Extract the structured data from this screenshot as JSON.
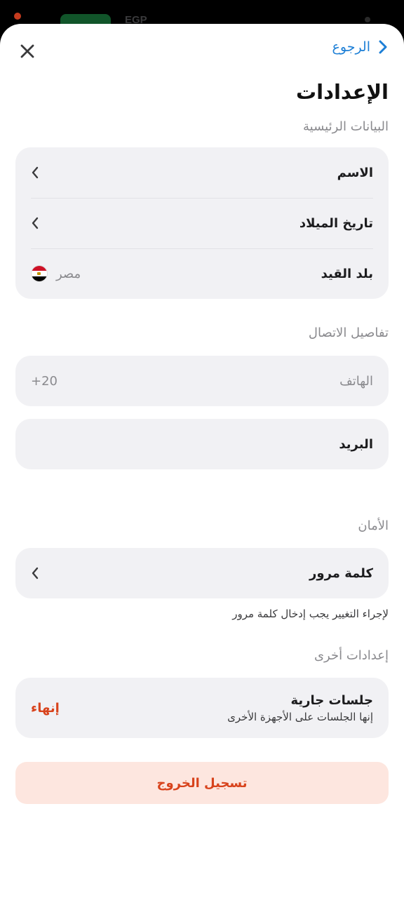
{
  "background": {
    "currency": "EGP"
  },
  "header": {
    "back_label": "الرجوع",
    "title": "الإعدادات"
  },
  "main_data": {
    "label": "البيانات الرئيسية",
    "name_label": "الاسم",
    "birthdate_label": "تاريخ الميلاد",
    "country_label": "بلد القيد",
    "country_value": "مصر"
  },
  "contact": {
    "label": "تفاصيل الاتصال",
    "phone_label": "الهاتف",
    "phone_prefix": "+20",
    "email_label": "البريد"
  },
  "security": {
    "label": "الأمان",
    "password_label": "كلمة مرور",
    "helper": "لإجراء التغيير يجب إدخال كلمة مرور"
  },
  "other": {
    "label": "إعدادات أخرى",
    "sessions_label": "جلسات جارية",
    "sessions_sub": "إنها الجلسات على الأجهزة الأخرى",
    "end_label": "إنهاء"
  },
  "logout_label": "تسجيل الخروج",
  "colors": {
    "accent": "#1d7fd6",
    "danger": "#d8431c",
    "danger_bg": "#fde6df",
    "card": "#f1f1f4"
  }
}
